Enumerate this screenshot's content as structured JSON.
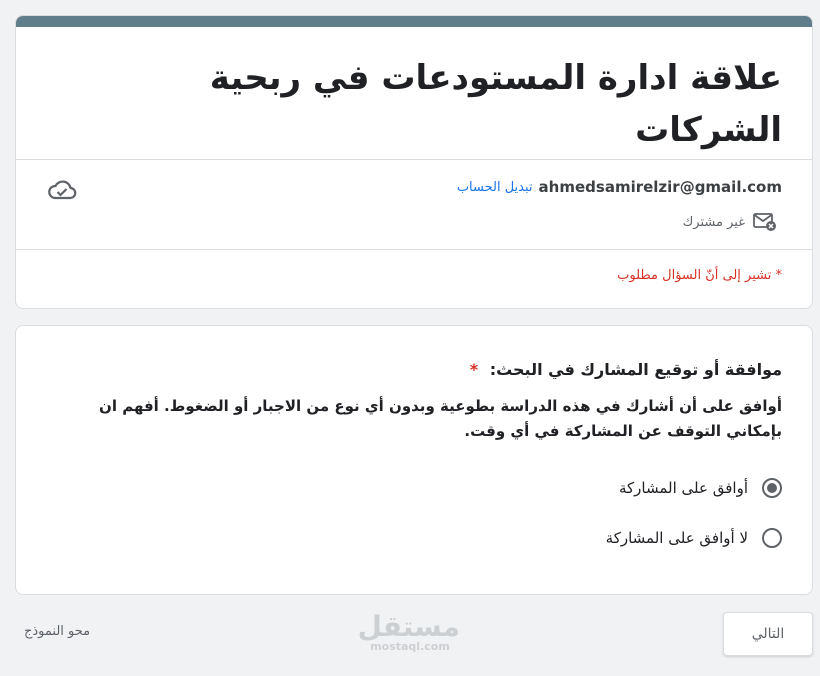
{
  "header": {
    "title": "علاقة ادارة المستودعات في ربحية الشركات",
    "email": "ahmedsamirelzir@gmail.com",
    "switch_account": "تبديل الحساب",
    "not_shared": "غير مشترك",
    "required_note": "* تشير إلى أنّ السؤال مطلوب"
  },
  "question": {
    "title": "موافقة أو توقيع المشارك في البحث:",
    "required_mark": "*",
    "description": "أوافق على أن أشارك في هذه الدراسة بطوعية وبدون أي نوع من الاجبار أو الضغوط. أفهم ان بإمكاني التوقف عن المشاركة في أي وقت.",
    "options": [
      {
        "label": "أوافق على المشاركة",
        "selected": true
      },
      {
        "label": "لا أوافق على المشاركة",
        "selected": false
      }
    ]
  },
  "footer": {
    "next_label": "التالي",
    "clear_label": "محو النموذج"
  },
  "watermark": {
    "main": "مستقل",
    "sub": "mostaql.com"
  },
  "colors": {
    "accent": "#607d8b",
    "required": "#d93025",
    "link": "#1a73e8"
  }
}
